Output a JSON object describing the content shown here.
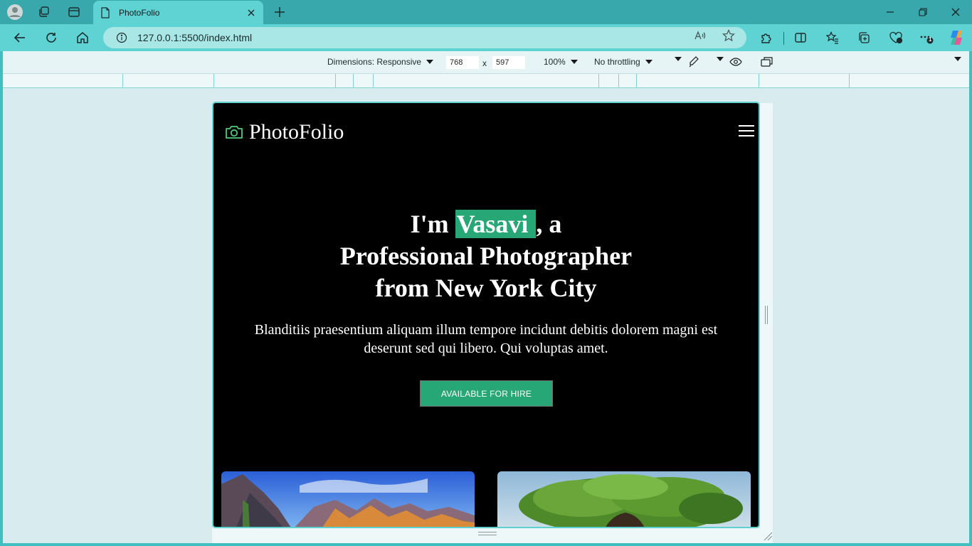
{
  "browser": {
    "tab_title": "PhotoFolio",
    "url": "127.0.0.1:5500/index.html",
    "extensions_badge": "1"
  },
  "devtools": {
    "dimensions_label": "Dimensions: Responsive",
    "width_value": "768",
    "times_symbol": "x",
    "height_value": "597",
    "zoom_label": "100%",
    "throttling_label": "No throttling"
  },
  "page": {
    "brand": "PhotoFolio",
    "hero": {
      "line1_prefix": "I'm ",
      "name": "Vasavi ",
      "line1_suffix": ", a",
      "line2": "Professional Photographer",
      "line3": "from New York City"
    },
    "subtitle": "Blanditiis praesentium aliquam illum tempore incidunt debitis dolorem magni est deserunt sed qui libero. Qui voluptas amet.",
    "cta_label": "AVAILABLE FOR HIRE"
  },
  "colors": {
    "accent_green": "#27a776",
    "chrome_teal": "#5fd3d3",
    "tabstrip_teal": "#38a8ac"
  }
}
